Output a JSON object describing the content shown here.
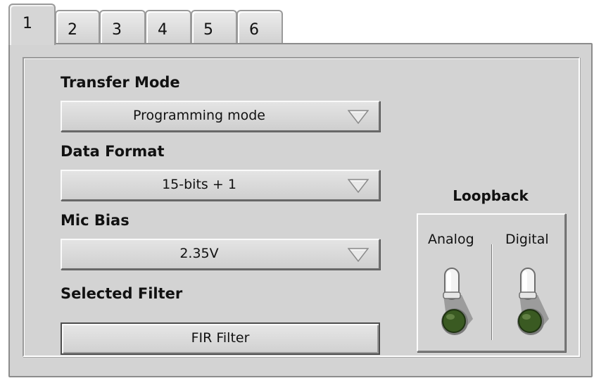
{
  "tabs": [
    {
      "label": "1",
      "active": true
    },
    {
      "label": "2",
      "active": false
    },
    {
      "label": "3",
      "active": false
    },
    {
      "label": "4",
      "active": false
    },
    {
      "label": "5",
      "active": false
    },
    {
      "label": "6",
      "active": false
    }
  ],
  "transfer_mode": {
    "label": "Transfer Mode",
    "value": "Programming mode"
  },
  "data_format": {
    "label": "Data Format",
    "value": "15-bits + 1"
  },
  "mic_bias": {
    "label": "Mic Bias",
    "value": "2.35V"
  },
  "selected_filter": {
    "label": "Selected Filter",
    "value": "FIR Filter"
  },
  "loopback": {
    "title": "Loopback",
    "analog_label": "Analog",
    "digital_label": "Digital",
    "analog_on": false,
    "digital_on": false
  },
  "colors": {
    "panel": "#d3d3d3",
    "led_off": "#3a5a22",
    "dropdown_face": "#dadada"
  },
  "icons": {
    "dropdown_arrow": "triangle-down-outline-icon",
    "toggle": "toggle-switch-icon",
    "led": "led-indicator-icon"
  }
}
